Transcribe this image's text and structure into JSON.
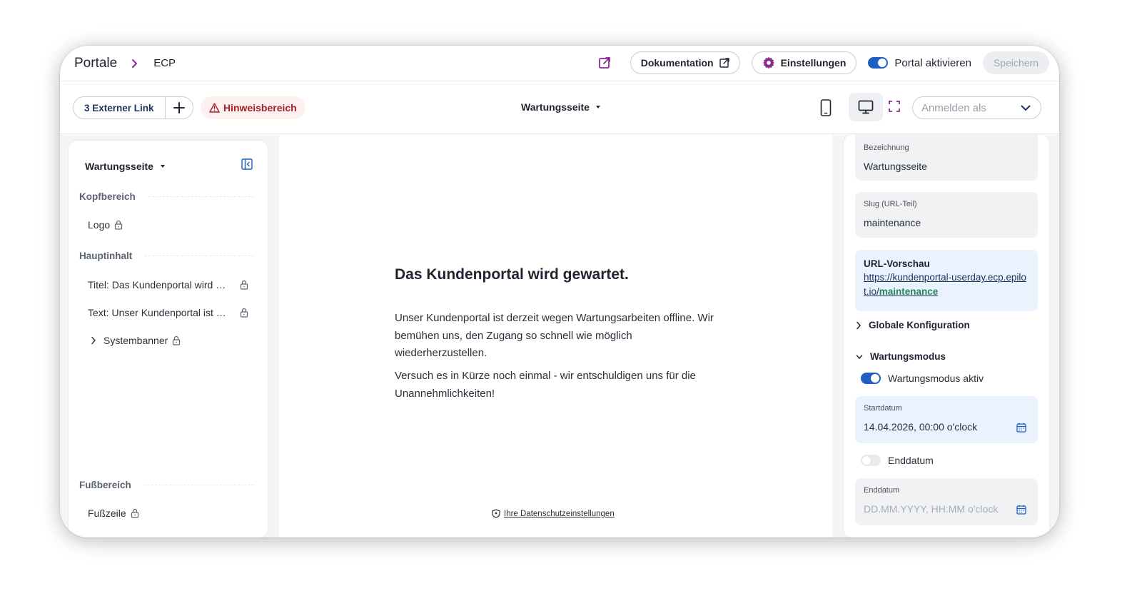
{
  "breadcrumb": {
    "root": "Portale",
    "current": "ECP"
  },
  "header": {
    "docs_label": "Dokumentation",
    "settings_label": "Einstellungen",
    "portal_toggle_label": "Portal aktivieren",
    "portal_active": true,
    "save_label": "Speichern"
  },
  "toolbar": {
    "external_link_label": "3 Externer Link",
    "hint_label": "Hinweisbereich",
    "page_select": "Wartungsseite",
    "login_as_placeholder": "Anmelden als"
  },
  "left_panel": {
    "page_title": "Wartungsseite",
    "sections": {
      "head": "Kopfbereich",
      "main": "Hauptinhalt",
      "foot": "Fußbereich"
    },
    "items": {
      "logo": "Logo",
      "title": "Titel: Das Kundenportal wird gewartet.",
      "text": "Text: Unser Kundenportal ist derzeit wegen Wartungsarbeiten offline.",
      "banner": "Systembanner",
      "footer": "Fußzeile"
    }
  },
  "preview": {
    "heading": "Das Kundenportal wird gewartet.",
    "paragraph1": "Unser Kundenportal ist derzeit wegen Wartungsarbeiten offline. Wir bemühen uns, den Zugang so schnell wie möglich wiederherzustellen.",
    "paragraph2": "Versuch es in Kürze noch einmal - wir entschuldigen uns für die Unannehmlichkeiten!",
    "privacy_link": "Ihre Datenschutzeinstellungen"
  },
  "right_panel": {
    "name_label": "Bezeichnung",
    "name_value": "Wartungsseite",
    "slug_label": "Slug (URL-Teil)",
    "slug_value": "maintenance",
    "url_preview_label": "URL-Vorschau",
    "url_base": "https://kundenportal-userday.ecp.epilot.io/",
    "url_slug": "maintenance",
    "global_config_label": "Globale Konfiguration",
    "maintenance_mode_label": "Wartungsmodus",
    "maintenance_active_label": "Wartungsmodus aktiv",
    "maintenance_active": true,
    "start_label": "Startdatum",
    "start_value": "14.04.2026, 00:00 o'clock",
    "end_toggle_label": "Enddatum",
    "end_toggle_on": false,
    "end_label": "Enddatum",
    "end_placeholder": "DD.MM.YYYY, HH:MM o'clock"
  },
  "colors": {
    "accent_purple": "#8a2a8f",
    "toggle_blue": "#1f5fbf",
    "hint_red": "#a3222b",
    "url_slug_green": "#1f8a55"
  }
}
